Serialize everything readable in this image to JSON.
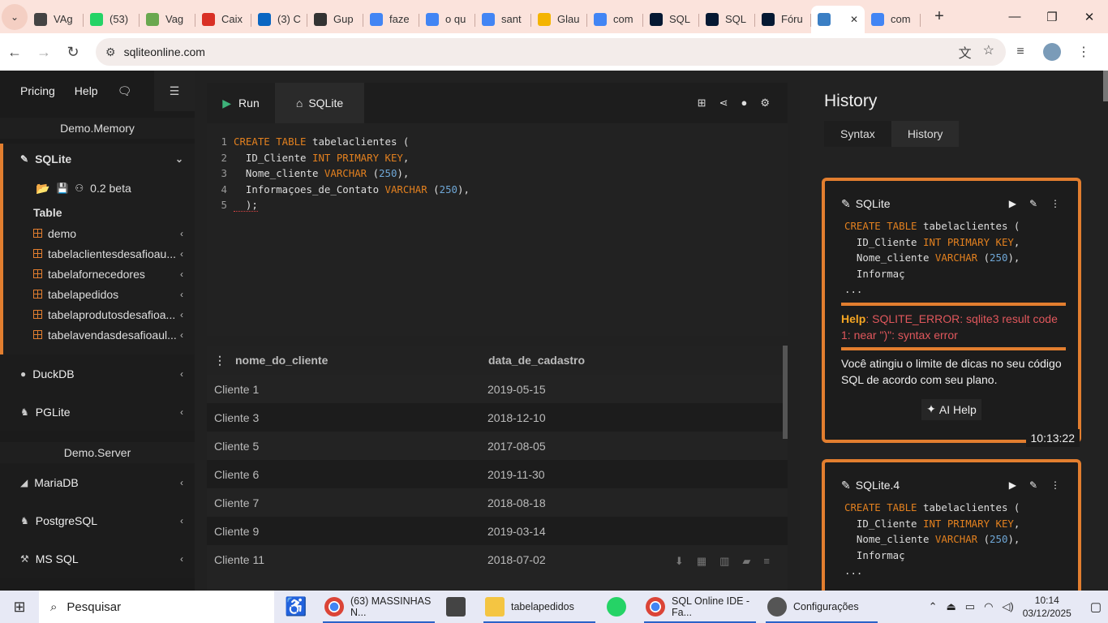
{
  "browser": {
    "tabs": [
      {
        "label": "VAg",
        "icon": "chrome-icon",
        "color": "#444"
      },
      {
        "label": "(53)",
        "icon": "whatsapp-icon",
        "color": "#25d366"
      },
      {
        "label": "Vag",
        "icon": "ai-icon",
        "color": "#6aa84f"
      },
      {
        "label": "Caix",
        "icon": "gmail-icon",
        "color": "#d93025"
      },
      {
        "label": "(3) C",
        "icon": "linkedin-icon",
        "color": "#0a66c2"
      },
      {
        "label": "Gup",
        "icon": "gupy-icon",
        "color": "#333"
      },
      {
        "label": "faze",
        "icon": "google-icon",
        "color": "#4285f4"
      },
      {
        "label": "o qu",
        "icon": "google-icon",
        "color": "#4285f4"
      },
      {
        "label": "sant",
        "icon": "google-icon",
        "color": "#4285f4"
      },
      {
        "label": "Glau",
        "icon": "drive-icon",
        "color": "#f4b400"
      },
      {
        "label": "com",
        "icon": "google-icon",
        "color": "#4285f4"
      },
      {
        "label": "SQL",
        "icon": "alura-icon",
        "color": "#051933"
      },
      {
        "label": "SQL",
        "icon": "alura-icon",
        "color": "#051933"
      },
      {
        "label": "Fóru",
        "icon": "alura-icon",
        "color": "#051933"
      },
      {
        "label": "",
        "icon": "sqlite-icon",
        "color": "#3b7fc4",
        "active": true
      },
      {
        "label": "com",
        "icon": "google-icon",
        "color": "#4285f4"
      }
    ],
    "url": "sqliteonline.com"
  },
  "sidebar": {
    "pricing": "Pricing",
    "help": "Help",
    "demo_memory": "Demo.Memory",
    "sqlite": "SQLite",
    "version": "0.2 beta",
    "table_label": "Table",
    "tables": [
      "demo",
      "tabelaclientesdesafioau...",
      "tabelafornecedores",
      "tabelapedidos",
      "tabelaprodutosdesafioa...",
      "tabelavendasdesafioaul..."
    ],
    "duckdb": "DuckDB",
    "pglite": "PGLite",
    "demo_server": "Demo.Server",
    "mariadb": "MariaDB",
    "postgresql": "PostgreSQL",
    "mssql": "MS SQL"
  },
  "editor": {
    "run": "Run",
    "engine": "SQLite",
    "lines": [
      [
        {
          "t": "CREATE TABLE",
          "c": "kw"
        },
        {
          "t": " tabelaclientes (",
          "c": ""
        }
      ],
      [
        {
          "t": "  ID_Cliente ",
          "c": ""
        },
        {
          "t": "INT PRIMARY KEY",
          "c": "kw"
        },
        {
          "t": ",",
          "c": ""
        }
      ],
      [
        {
          "t": "  Nome_cliente ",
          "c": ""
        },
        {
          "t": "VARCHAR",
          "c": "kw"
        },
        {
          "t": " (",
          "c": ""
        },
        {
          "t": "250",
          "c": "num"
        },
        {
          "t": "),",
          "c": ""
        }
      ],
      [
        {
          "t": "  Informaçoes_de_Contato ",
          "c": ""
        },
        {
          "t": "VARCHAR",
          "c": "kw"
        },
        {
          "t": " (",
          "c": ""
        },
        {
          "t": "250",
          "c": "num"
        },
        {
          "t": "),",
          "c": ""
        }
      ],
      [
        {
          "t": "  );",
          "c": "err"
        }
      ]
    ]
  },
  "results": {
    "columns": [
      "nome_do_cliente",
      "data_de_cadastro"
    ],
    "rows": [
      [
        "Cliente 1",
        "2019-05-15"
      ],
      [
        "Cliente 3",
        "2018-12-10"
      ],
      [
        "Cliente 5",
        "2017-08-05"
      ],
      [
        "Cliente 6",
        "2019-11-30"
      ],
      [
        "Cliente 7",
        "2018-08-18"
      ],
      [
        "Cliente 9",
        "2019-03-14"
      ],
      [
        "Cliente 11",
        "2018-07-02"
      ]
    ]
  },
  "history": {
    "title": "History",
    "tabs": [
      "Syntax",
      "History"
    ],
    "cards": [
      {
        "name": "SQLite",
        "code": [
          [
            {
              "t": "CREATE TABLE",
              "c": "kw"
            },
            {
              "t": " tabelaclientes (",
              "c": ""
            }
          ],
          [
            {
              "t": "  ID_Cliente ",
              "c": ""
            },
            {
              "t": "INT PRIMARY KEY",
              "c": "kw"
            },
            {
              "t": ",",
              "c": ""
            }
          ],
          [
            {
              "t": "  Nome_cliente ",
              "c": ""
            },
            {
              "t": "VARCHAR",
              "c": "kw"
            },
            {
              "t": " (",
              "c": ""
            },
            {
              "t": "250",
              "c": "num"
            },
            {
              "t": "),",
              "c": ""
            }
          ],
          [
            {
              "t": "  Informaç",
              "c": ""
            }
          ],
          [
            {
              "t": "...",
              "c": ""
            }
          ]
        ],
        "help_label": "Help",
        "help_text": ": SQLITE_ERROR: sqlite3 result code 1: near \")\": syntax error",
        "limit": "Você atingiu o limite de dicas no seu código SQL de acordo com seu plano.",
        "ai": "AI Help",
        "time": "10:13:22"
      },
      {
        "name": "SQLite.4",
        "code": [
          [
            {
              "t": "CREATE TABLE",
              "c": "kw"
            },
            {
              "t": " tabelaclientes (",
              "c": ""
            }
          ],
          [
            {
              "t": "  ID_Cliente ",
              "c": ""
            },
            {
              "t": "INT PRIMARY KEY",
              "c": "kw"
            },
            {
              "t": ",",
              "c": ""
            }
          ],
          [
            {
              "t": "  Nome_cliente ",
              "c": ""
            },
            {
              "t": "VARCHAR",
              "c": "kw"
            },
            {
              "t": " (",
              "c": ""
            },
            {
              "t": "250",
              "c": "num"
            },
            {
              "t": "),",
              "c": ""
            }
          ],
          [
            {
              "t": "  Informaç",
              "c": ""
            }
          ],
          [
            {
              "t": "...",
              "c": ""
            }
          ]
        ]
      }
    ]
  },
  "taskbar": {
    "search": "Pesquisar",
    "items": [
      {
        "label": "(63) MASSINHAS N...",
        "icon": "chrome-icon",
        "open": true
      },
      {
        "label": "",
        "icon": "calculator-icon",
        "open": false
      },
      {
        "label": "tabelapedidos",
        "icon": "folder-icon",
        "open": true
      },
      {
        "label": "",
        "icon": "whatsapp-icon",
        "open": false
      },
      {
        "label": "SQL Online IDE - Fa...",
        "icon": "chrome-icon",
        "open": true
      },
      {
        "label": "Configurações",
        "icon": "gear-icon",
        "open": true
      }
    ],
    "time": "10:14",
    "date": "03/12/2025"
  }
}
